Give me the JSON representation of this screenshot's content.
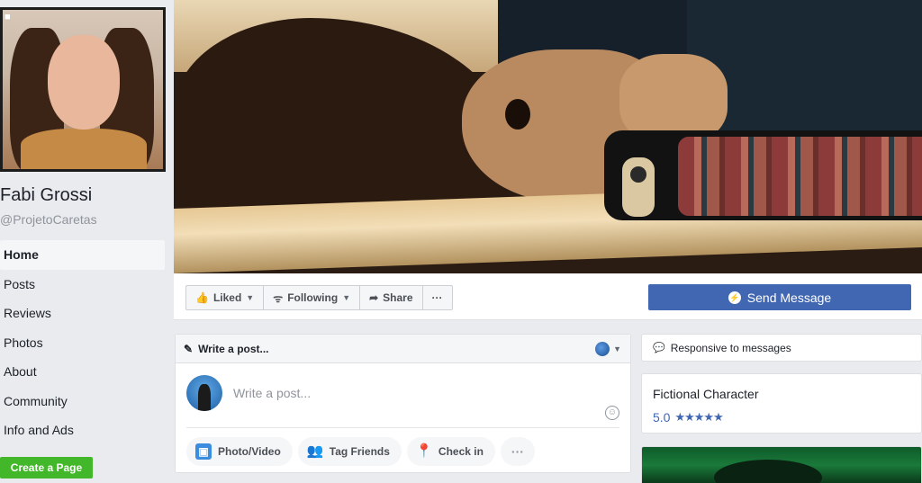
{
  "profile": {
    "name": "Fabi Grossi",
    "handle": "@ProjetoCaretas"
  },
  "nav": {
    "items": [
      "Home",
      "Posts",
      "Reviews",
      "Photos",
      "About",
      "Community",
      "Info and Ads"
    ],
    "active": "Home"
  },
  "create_page_label": "Create a Page",
  "action_bar": {
    "liked_label": "Liked",
    "following_label": "Following",
    "share_label": "Share",
    "more_label": "···",
    "send_message_label": "Send Message"
  },
  "composer": {
    "header_label": "Write a post...",
    "placeholder": "Write a post...",
    "actions": {
      "photo_video": "Photo/Video",
      "tag_friends": "Tag Friends",
      "check_in": "Check in",
      "more": "···"
    }
  },
  "sidebar_right": {
    "responsive_label": "Responsive to messages",
    "category": "Fictional Character",
    "rating_value": "5.0",
    "rating_stars": "★★★★★"
  },
  "colors": {
    "facebook_blue": "#4267b2",
    "create_green": "#42b72a",
    "background": "#e9ebee"
  },
  "icons": {
    "camera": "📷",
    "thumb": "👍",
    "rss": "📶",
    "share": "➦",
    "pencil": "✎",
    "messenger": "💬"
  }
}
